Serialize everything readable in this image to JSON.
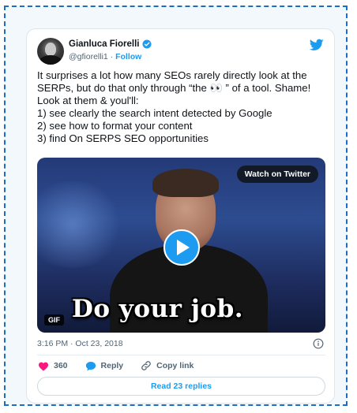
{
  "author": {
    "name": "Gianluca Fiorelli",
    "handle": "@gfiorelli1",
    "separator": " · ",
    "follow_label": "Follow"
  },
  "tweet": {
    "text": "It surprises a lot how many SEOs rarely directly look at the\nSERPs, but do that only through “the 👀 ” of a tool. Shame!\nLook at them & youl'll:\n1) see clearly the search intent detected by Google\n2) see how to format your content\n3) find On SERPS SEO opportunities",
    "timestamp": "3:16 PM · Oct 23, 2018"
  },
  "media": {
    "watch_label": "Watch on Twitter",
    "caption": "Do your job.",
    "gif_badge": "GIF"
  },
  "actions": {
    "likes_count": "360",
    "reply_label": "Reply",
    "copy_link_label": "Copy link",
    "read_replies_label": "Read 23 replies"
  },
  "colors": {
    "twitter_blue": "#1d9bf0",
    "like_red": "#f91880",
    "frame_border": "#1a6fc4"
  },
  "icons": [
    "verified-badge-icon",
    "twitter-bird-icon",
    "play-icon",
    "info-icon",
    "heart-icon",
    "reply-bubble-icon",
    "link-icon"
  ]
}
